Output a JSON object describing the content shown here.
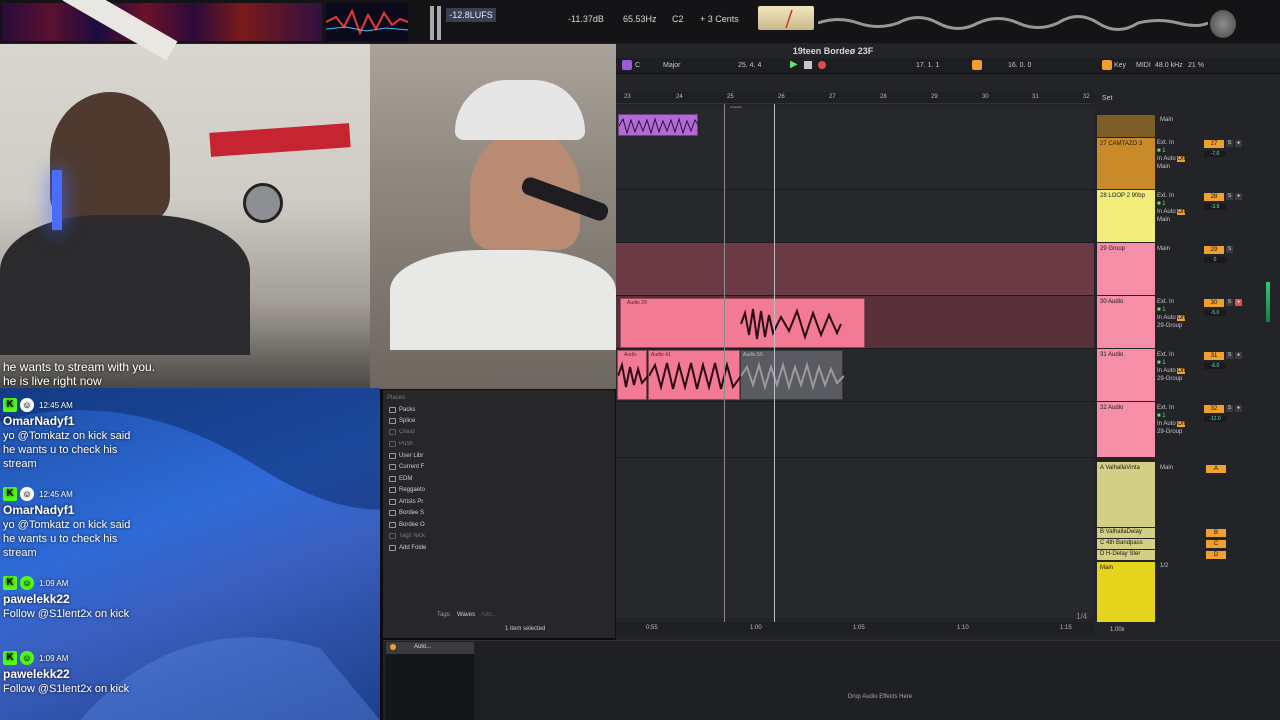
{
  "meters": {
    "lufs": "-12.8LUFS",
    "db": "-11.37dB",
    "hz": "65.53Hz",
    "note": "C2",
    "cents": "+ 3 Cents"
  },
  "chat": {
    "top_message": "he wants to stream with you. he is live right now",
    "entries": [
      {
        "time": "12:45 AM",
        "user": "OmarNadyf1",
        "text": "yo @Tomkatz on kick said he wants u to check his stream"
      },
      {
        "time": "12:45 AM",
        "user": "OmarNadyf1",
        "text": "yo @Tomkatz on kick said he wants u to check his stream"
      },
      {
        "time": "1:09 AM",
        "user": "pawelekk22",
        "text": "Follow @S1lent2x on kick"
      },
      {
        "time": "1:09 AM",
        "user": "pawelekk22",
        "text": "Follow @S1lent2x on kick"
      }
    ]
  },
  "browser": {
    "places_label": "Places",
    "items": [
      "Packs",
      "Splice",
      "Cloud",
      "Push",
      "User Libr",
      "Current F",
      "EDM",
      "Reggaeto",
      "Artists Pr",
      "Bordee S",
      "Bordee O",
      "Tags Nick",
      "Add Folde"
    ],
    "tags_label": "Tags:",
    "tags_value": "Waves",
    "tags_add": "Add...",
    "status": "1 item selected"
  },
  "daw": {
    "title": "19teen Bordeø 23F",
    "key_root": "C",
    "scale": "Major",
    "position": "25.  4.  4",
    "loop_start": "17.  1.  1",
    "loop_len": "16.  0.  0",
    "key_label": "Key",
    "midi_label": "MIDI",
    "sample_rate": "48.0 kHz",
    "cpu": "21 %",
    "set_label": "Set",
    "bars": [
      "23",
      "24",
      "25",
      "26",
      "27",
      "28",
      "29",
      "30",
      "31",
      "32"
    ],
    "locator": "coro",
    "times": [
      "0:55",
      "1:00",
      "1:05",
      "1:10",
      "1:15"
    ],
    "zoom_fraction": "1/4",
    "clip_labels": [
      "Audio 29",
      "Audio",
      "Audio 41",
      "Audio 55"
    ],
    "tracks": [
      {
        "name": "27 CAMTAZO 3",
        "num": "27",
        "vol": "-7.0",
        "input": "Ext. In",
        "out": "Main",
        "color": "#c98a2a"
      },
      {
        "name": "28 LOOP 2 90bp",
        "num": "28",
        "vol": "-3.9",
        "input": "Ext. In",
        "out": "Main",
        "color": "#f2ed7a"
      },
      {
        "name": "29 Group",
        "num": "29",
        "vol": "0",
        "input": "",
        "out": "Main",
        "color": "#f58fa8"
      },
      {
        "name": "30 Audio",
        "num": "30",
        "vol": "-5.0",
        "input": "Ext. In",
        "out": "29-Group",
        "color": "#f58fa8"
      },
      {
        "name": "31 Audio",
        "num": "31",
        "vol": "-6.0",
        "input": "Ext. In",
        "out": "29-Group",
        "color": "#f58fa8"
      },
      {
        "name": "32 Audio",
        "num": "32",
        "vol": "-12.0",
        "input": "Ext. In",
        "out": "29-Group",
        "color": "#f58fa8"
      }
    ],
    "returns": [
      {
        "name": "A ValhallaVinta",
        "num": "A"
      },
      {
        "name": "B ValhallaDelay",
        "num": "B"
      },
      {
        "name": "C 4th Bandpass",
        "num": "C"
      },
      {
        "name": "D H-Delay Ster",
        "num": "D"
      }
    ],
    "main": {
      "name": "Main",
      "fraction": "1/2"
    },
    "monitor_in": "In",
    "monitor_auto": "Auto",
    "monitor_off": "Off",
    "bottom_zoom": "1.00x",
    "drop_text": "Drop Audio Effects Here",
    "device_name": "Auto..."
  }
}
